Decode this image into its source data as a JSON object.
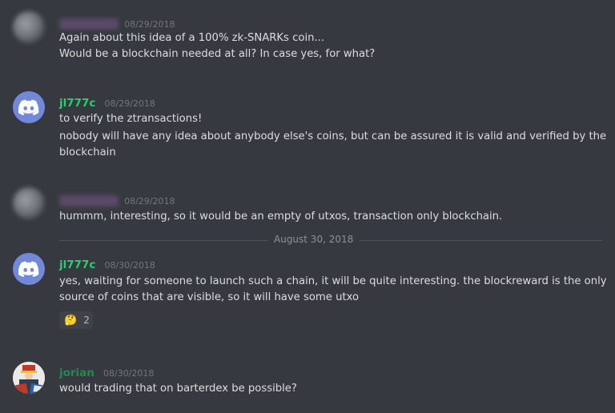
{
  "messages": [
    {
      "user": "",
      "timestamp": "08/29/2018",
      "lines": [
        "Again about this idea of a 100% zk-SNARKs coin...",
        "Would be a blockchain needed at all? In case yes, for what?"
      ]
    },
    {
      "user": "jl777c",
      "timestamp": "08/29/2018",
      "lines": [
        "to verify the ztransactions!",
        "nobody will have any idea about anybody else's coins, but can be assured it is valid and verified by the",
        "blockchain"
      ]
    },
    {
      "user": "",
      "timestamp": "08/29/2018",
      "lines": [
        "hummm, interesting, so it would be an empty of utxos, transaction only blockchain."
      ]
    },
    {
      "user": "jl777c",
      "timestamp": "08/30/2018",
      "lines": [
        "yes, waiting for someone to launch such a chain, it will be quite interesting. the blockreward is the only",
        "source of coins that are visible, so it will have some utxo"
      ],
      "reaction": {
        "emoji": "🤔",
        "count": "2"
      }
    },
    {
      "user": "jorian",
      "timestamp": "08/30/2018",
      "lines": [
        "would trading that on barterdex be possible?"
      ]
    }
  ],
  "date_divider": "August 30, 2018",
  "colors": {
    "background": "#36393f",
    "username_jl777c": "#2ecc71",
    "username_jorian": "#1f8b4c",
    "discord_blurple": "#7289da"
  },
  "icons": {
    "discord_avatar": "discord-logo-icon",
    "reaction": "thinking-face-emoji"
  }
}
